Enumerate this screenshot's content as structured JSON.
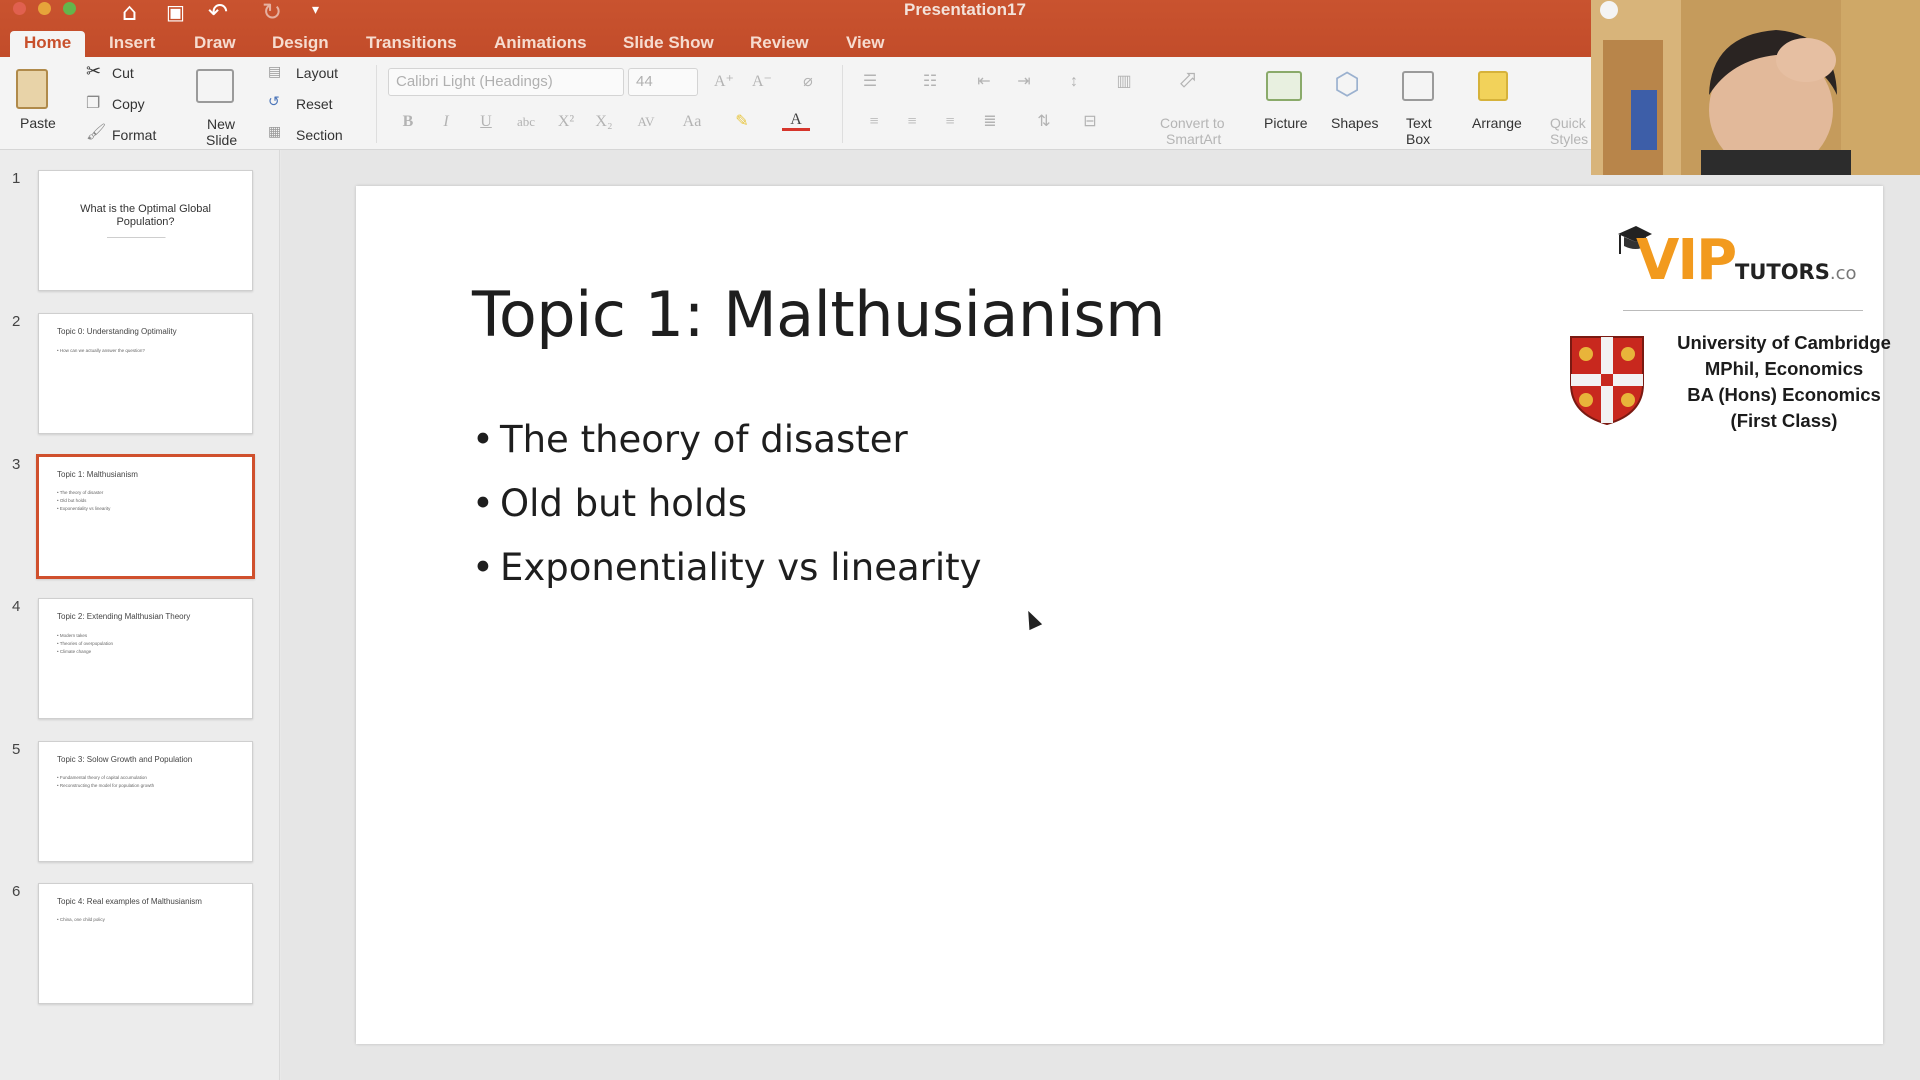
{
  "window": {
    "title": "Presentation17"
  },
  "tabs": [
    "Home",
    "Insert",
    "Draw",
    "Design",
    "Transitions",
    "Animations",
    "Slide Show",
    "Review",
    "View"
  ],
  "ribbon": {
    "paste": "Paste",
    "cut": "Cut",
    "copy": "Copy",
    "format": "Format",
    "new_slide": [
      "New",
      "Slide"
    ],
    "layout": "Layout",
    "reset": "Reset",
    "section": "Section",
    "font_name": "Calibri Light (Headings)",
    "font_size": "44",
    "convert_smartart": [
      "Convert to",
      "SmartArt"
    ],
    "picture": "Picture",
    "shapes": "Shapes",
    "text_box": [
      "Text",
      "Box"
    ],
    "arrange": "Arrange",
    "quick_styles": [
      "Quick",
      "Styles"
    ]
  },
  "thumbnails": [
    {
      "num": "1",
      "title": "What is the Optimal Global Population?",
      "lines": [
        "—————————————"
      ]
    },
    {
      "num": "2",
      "title": "Topic 0: Understanding Optimality",
      "lines": [
        "• How can we actually answer the question?"
      ]
    },
    {
      "num": "3",
      "title": "Topic 1: Malthusianism",
      "lines": [
        "• The theory of disaster",
        "• Old but holds",
        "• Exponentiality vs linearity"
      ]
    },
    {
      "num": "4",
      "title": "Topic 2: Extending Malthusian Theory",
      "lines": [
        "• Modern takes",
        "• Theories of overpopulation",
        "• Climate change"
      ]
    },
    {
      "num": "5",
      "title": "Topic 3: Solow Growth and Population",
      "lines": [
        "• Fundamental theory of capital accumulation",
        "• Reconstructing the model for population growth"
      ]
    },
    {
      "num": "6",
      "title": "Topic 4: Real examples of Malthusianism",
      "lines": [
        "• China, one child policy"
      ]
    }
  ],
  "slide": {
    "title": "Topic 1: Malthusianism",
    "bullets": [
      "The theory of disaster",
      "Old but holds",
      "Exponentiality vs linearity"
    ]
  },
  "branding": {
    "logo_main": "VIP",
    "logo_tutors": "TUTORS",
    "logo_co": ".co",
    "credentials": [
      "University of Cambridge",
      "MPhil, Economics",
      "BA (Hons) Economics",
      "(First Class)"
    ]
  },
  "colors": {
    "accent": "#c9532f",
    "logo_orange": "#f29a1e",
    "selection": "#d0502d"
  }
}
